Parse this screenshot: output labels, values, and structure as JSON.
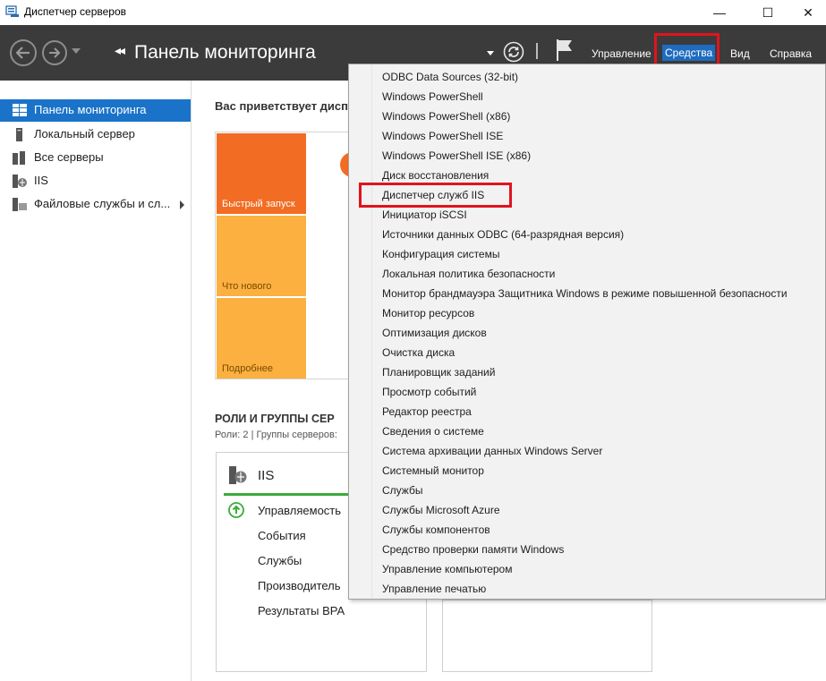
{
  "window": {
    "title": "Диспетчер серверов",
    "minimize": "—",
    "maximize": "☐",
    "close": "✕"
  },
  "header": {
    "title": "Панель мониторинга",
    "breadcrumb_arrows": "◂◂",
    "menu": {
      "manage": "Управление",
      "tools": "Средства",
      "view": "Вид",
      "help": "Справка"
    }
  },
  "sidebar": {
    "items": [
      {
        "label": "Панель мониторинга",
        "icon": "dashboard-icon",
        "active": true
      },
      {
        "label": "Локальный сервер",
        "icon": "server-icon"
      },
      {
        "label": "Все серверы",
        "icon": "servers-icon"
      },
      {
        "label": "IIS",
        "icon": "iis-icon"
      },
      {
        "label": "Файловые службы и сл...",
        "icon": "file-services-icon"
      }
    ]
  },
  "main": {
    "welcome": "Вас приветствует дисп",
    "tiles": [
      "Быстрый запуск",
      "Что нового",
      "Подробнее"
    ],
    "roles_title": "РОЛИ И ГРУППЫ СЕР",
    "roles_subtitle": "Роли: 2 | Группы серверов:",
    "role_card": {
      "title": "IIS",
      "rows": [
        "Управляемость",
        "События",
        "Службы",
        "Производитель",
        "Результаты BPA"
      ]
    }
  },
  "tools_menu": {
    "items": [
      "ODBC Data Sources (32-bit)",
      "Windows PowerShell",
      "Windows PowerShell (x86)",
      "Windows PowerShell ISE",
      "Windows PowerShell ISE (x86)",
      "Диск восстановления",
      "Диспетчер служб IIS",
      "Инициатор iSCSI",
      "Источники данных ODBC (64-разрядная версия)",
      "Конфигурация системы",
      "Локальная политика безопасности",
      "Монитор брандмауэра Защитника Windows в режиме повышенной безопасности",
      "Монитор ресурсов",
      "Оптимизация дисков",
      "Очистка диска",
      "Планировщик заданий",
      "Просмотр событий",
      "Редактор реестра",
      "Сведения о системе",
      "Система архивации данных Windows Server",
      "Системный монитор",
      "Службы",
      "Службы Microsoft Azure",
      "Службы компонентов",
      "Средство проверки памяти Windows",
      "Управление компьютером",
      "Управление печатью"
    ],
    "highlighted": "Диспетчер служб IIS"
  },
  "colors": {
    "header_bg": "#3b3b3b",
    "accent": "#1a73c9",
    "tile_orange": "#f26d23",
    "tile_amber": "#fbb040",
    "highlight_red": "#e0141e",
    "status_green": "#3aac3a"
  }
}
